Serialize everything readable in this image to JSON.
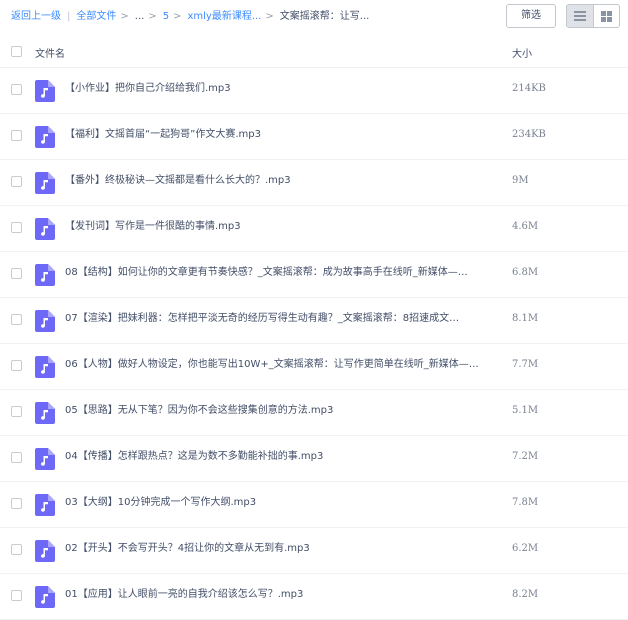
{
  "toolbar": {
    "back_label": "返回上一级",
    "separator": "|",
    "all_files_label": "全部文件",
    "ellipsis": "...",
    "crumb_5": "5",
    "crumb_course": "xmly最新课程...",
    "crumb_current": "文案摇滚帮：让写...",
    "filter_label": "筛选",
    "view_list_icon": "list-view-icon",
    "view_grid_icon": "grid-view-icon"
  },
  "table": {
    "col_name": "文件名",
    "col_size": "大小"
  },
  "colors": {
    "link": "#3b8cff",
    "music_icon": "#6d68f5"
  },
  "files": [
    {
      "name": "【小作业】把你自己介绍给我们.mp3",
      "size": "214KB"
    },
    {
      "name": "【福利】文摇首届“一起狗哥”作文大赛.mp3",
      "size": "234KB"
    },
    {
      "name": "【番外】终极秘诀—文摇都是看什么长大的？.mp3",
      "size": "9M"
    },
    {
      "name": "【发刊词】写作是一件很酷的事情.mp3",
      "size": "4.6M"
    },
    {
      "name": "08【结构】如何让你的文章更有节奏快感？_文案摇滚帮：成为故事高手在线听_新媒体—…",
      "size": "6.8M"
    },
    {
      "name": "07【渲染】把妹利器：怎样把平淡无奇的经历写得生动有趣？_文案摇滚帮：8招速成文…",
      "size": "8.1M"
    },
    {
      "name": "06【人物】做好人物设定，你也能写出10W+_文案摇滚帮：让写作更简单在线听_新媒体—…",
      "size": "7.7M"
    },
    {
      "name": "05【思路】无从下笔？因为你不会这些搜集创意的方法.mp3",
      "size": "5.1M"
    },
    {
      "name": "04【传播】怎样跟热点？这是为数不多勤能补拙的事.mp3",
      "size": "7.2M"
    },
    {
      "name": "03【大纲】10分钟完成一个写作大纲.mp3",
      "size": "7.8M"
    },
    {
      "name": "02【开头】不会写开头？4招让你的文章从无到有.mp3",
      "size": "6.2M"
    },
    {
      "name": "01【应用】让人眼前一亮的自我介绍该怎么写？.mp3",
      "size": "8.2M"
    }
  ]
}
